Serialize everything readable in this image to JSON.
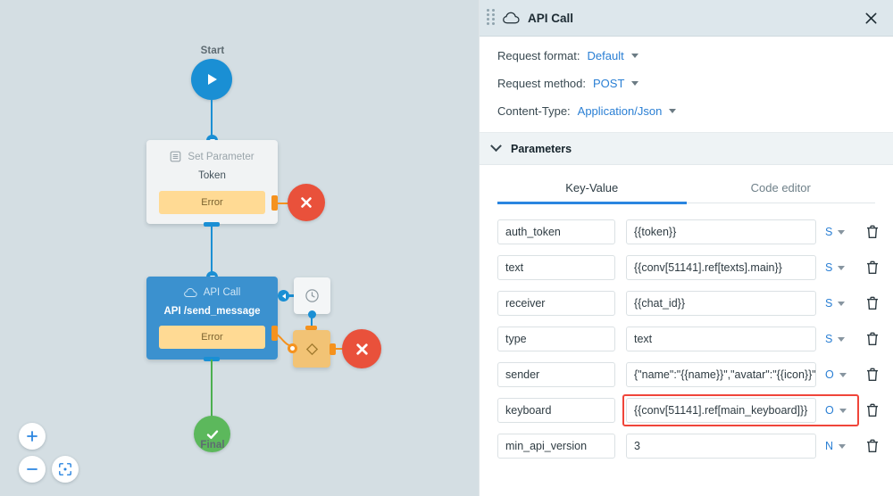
{
  "canvas": {
    "background_color": "#d4dee3",
    "nodes": [
      {
        "id": "start",
        "label": "Start",
        "icon": "play-icon",
        "color": "#1a8fd4"
      },
      {
        "id": "set-parameter",
        "header": "Set Parameter",
        "header_icon": "list-icon",
        "title": "Token",
        "error_label": "Error",
        "color": "#f1f3f4"
      },
      {
        "id": "api-call",
        "header": "API Call",
        "header_icon": "cloud-icon",
        "title": "API /send_message",
        "error_label": "Error",
        "color": "#3b91cf"
      },
      {
        "id": "timer",
        "icon": "clock-icon",
        "color": "#f4f6f7"
      },
      {
        "id": "condition",
        "icon": "diamond-icon",
        "color": "#f2c375"
      },
      {
        "id": "final",
        "label": "Final",
        "icon": "check-icon",
        "color": "#5cb85c"
      },
      {
        "id": "error-1",
        "icon": "close-icon",
        "color": "#e9513b"
      },
      {
        "id": "error-2",
        "icon": "close-icon",
        "color": "#e9513b"
      }
    ],
    "zoom_controls": [
      {
        "name": "zoom-in",
        "glyph": "+"
      },
      {
        "name": "zoom-out",
        "glyph": "−"
      },
      {
        "name": "fit-to-screen",
        "glyph": "target"
      }
    ]
  },
  "panel": {
    "title": "API Call",
    "title_icon": "cloud-icon",
    "drag_handle": "drag-handle-icon",
    "close_icon": "close-icon",
    "meta": [
      {
        "label": "Request format:",
        "value": "Default"
      },
      {
        "label": "Request method:",
        "value": "POST"
      },
      {
        "label": "Content-Type:",
        "value": "Application/Json"
      }
    ],
    "section": {
      "title": "Parameters",
      "expanded": true
    },
    "tabs": [
      {
        "label": "Key-Value",
        "active": true
      },
      {
        "label": "Code editor",
        "active": false
      }
    ],
    "parameters": [
      {
        "key": "auth_token",
        "value": "{{token}}",
        "type": "S",
        "highlighted": false
      },
      {
        "key": "text",
        "value": "{{conv[51141].ref[texts].main}}",
        "type": "S",
        "highlighted": false
      },
      {
        "key": "receiver",
        "value": "{{chat_id}}",
        "type": "S",
        "highlighted": false
      },
      {
        "key": "type",
        "value": "text",
        "type": "S",
        "highlighted": false
      },
      {
        "key": "sender",
        "value": "{\"name\":\"{{name}}\",\"avatar\":\"{{icon}}\"}",
        "type": "O",
        "highlighted": false
      },
      {
        "key": "keyboard",
        "value": "{{conv[51141].ref[main_keyboard]}}",
        "type": "O",
        "highlighted": true
      },
      {
        "key": "min_api_version",
        "value": "3",
        "type": "N",
        "highlighted": false
      }
    ],
    "delete_icon": "trash-icon",
    "accent_color": "#2a85e0",
    "highlight_color": "#f0453a"
  }
}
